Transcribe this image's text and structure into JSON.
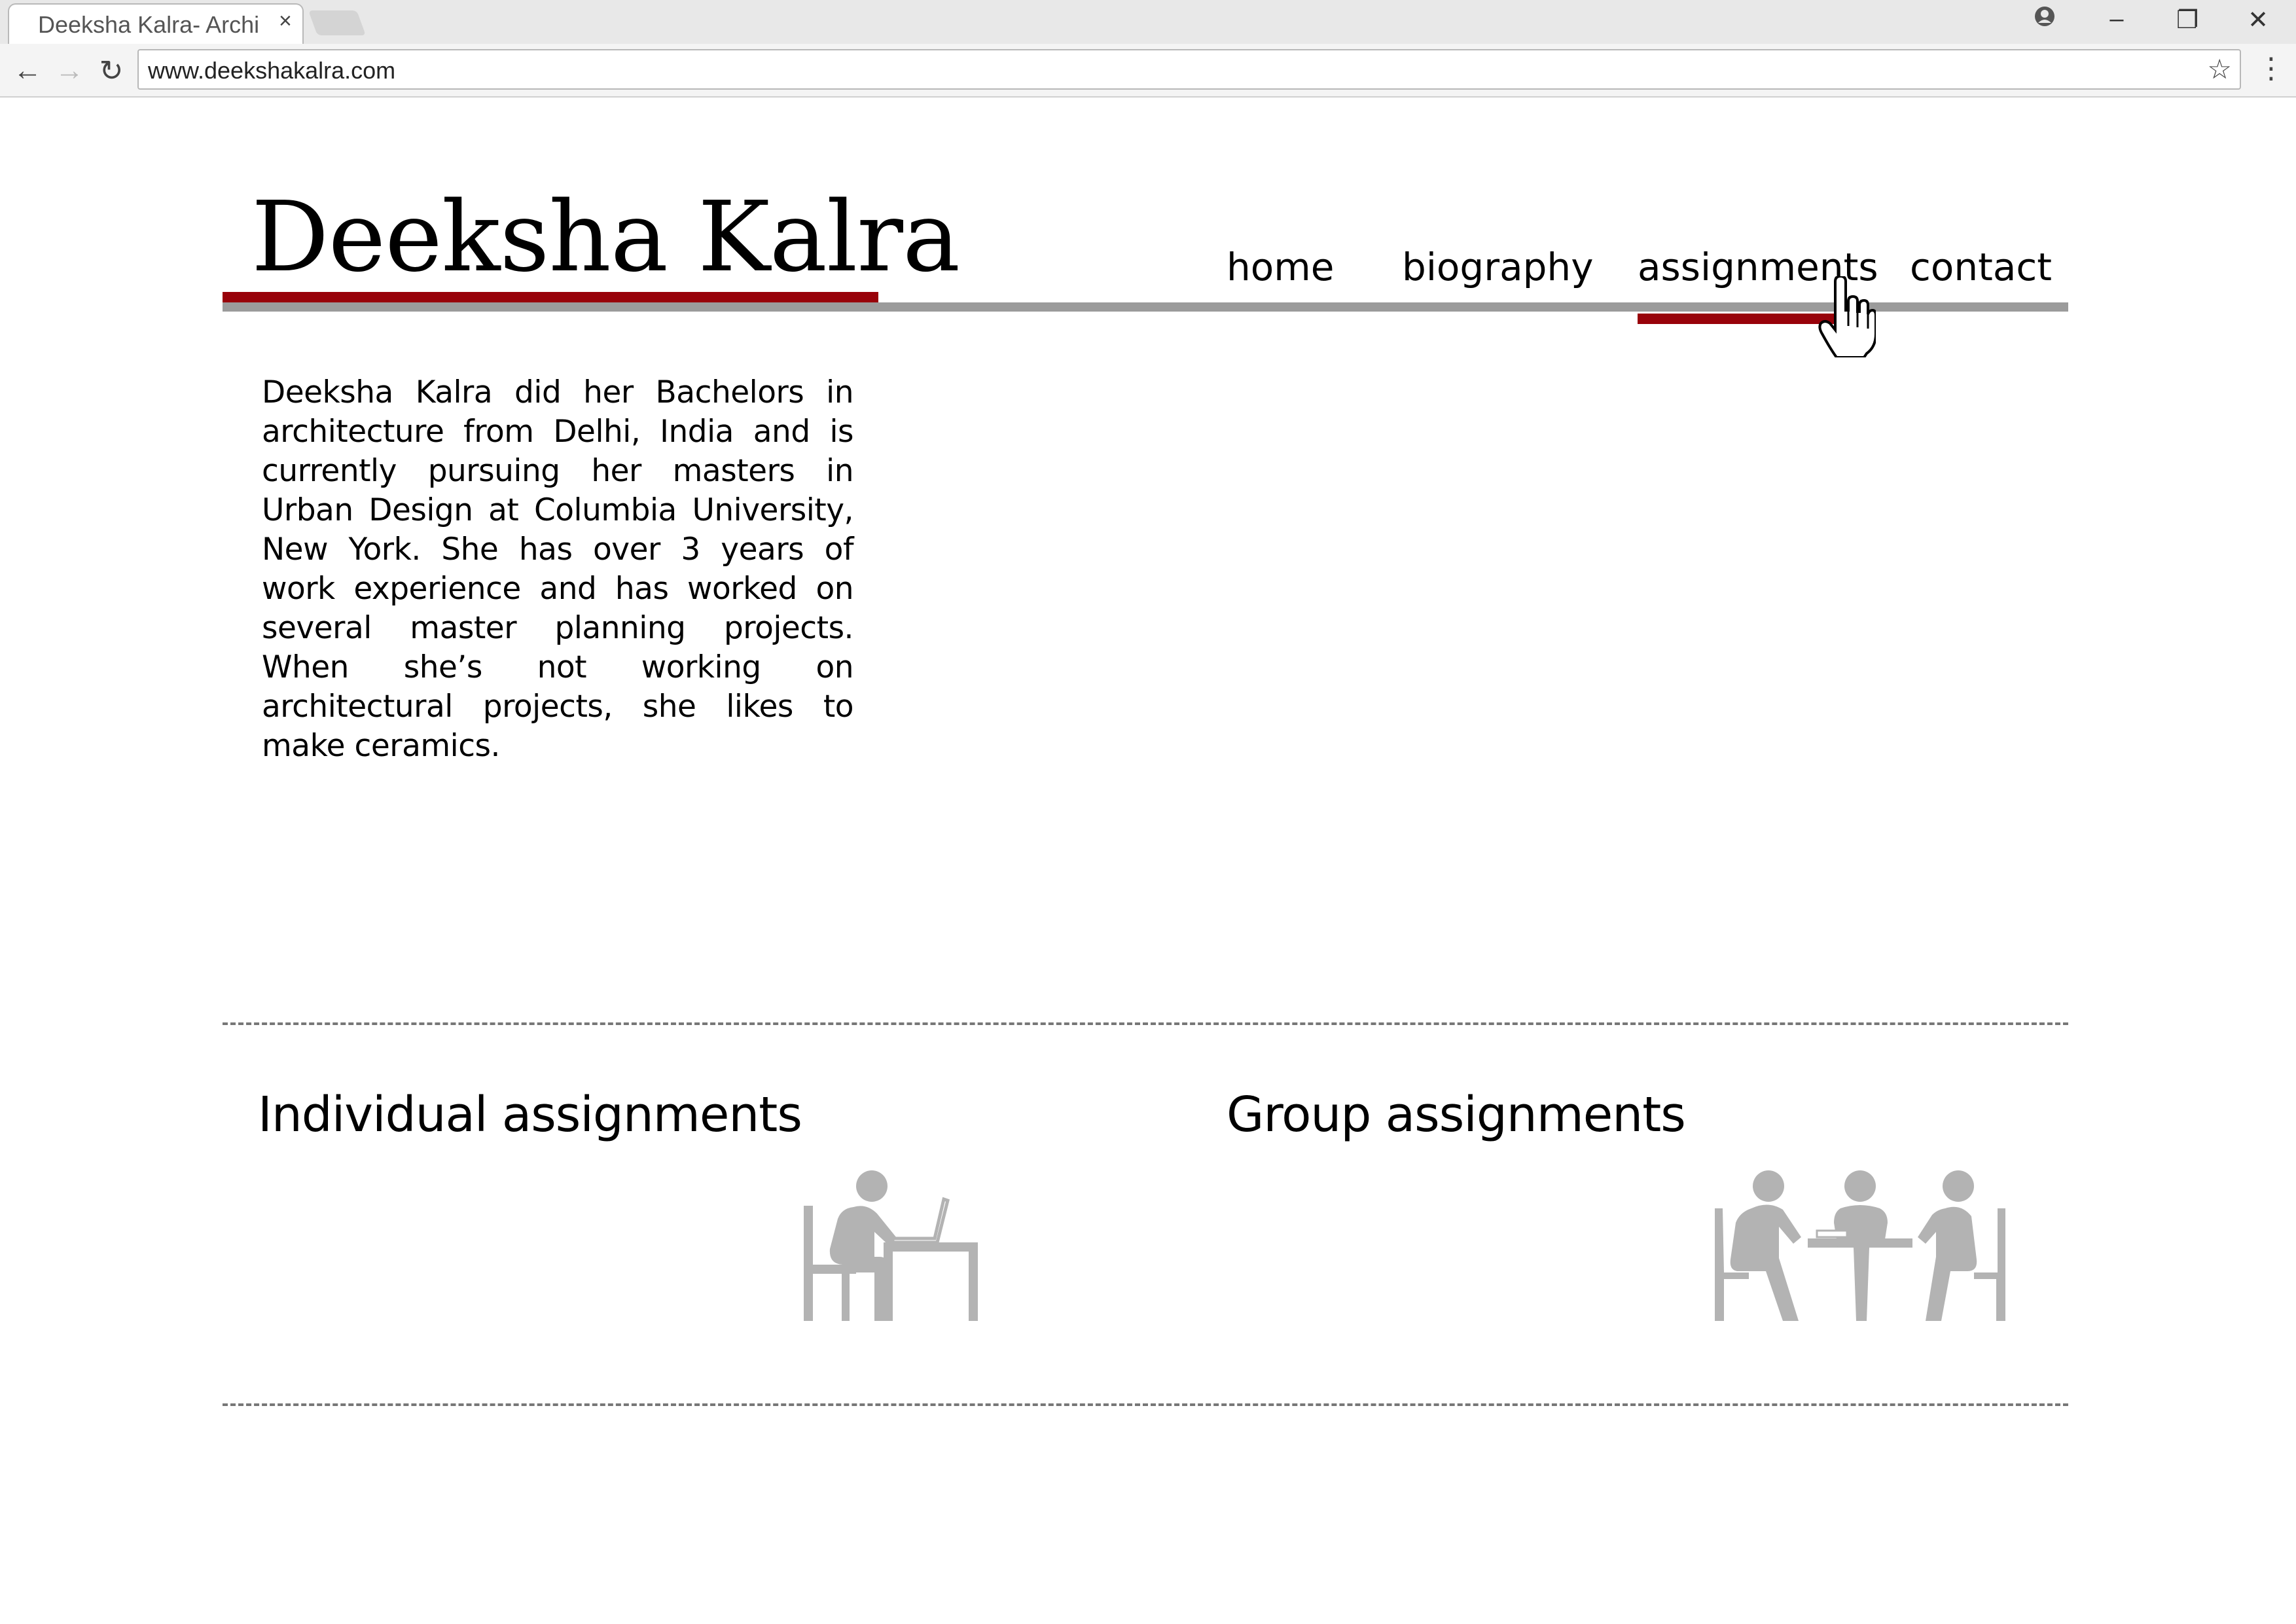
{
  "browser": {
    "tab_title": "Deeksha Kalra- Archi",
    "tab_close": "×",
    "url": "www.deekshakalra.com",
    "controls": {
      "back": "←",
      "forward": "→",
      "reload": "↻",
      "star": "☆",
      "menu": "⋮",
      "profile": "●",
      "minimize": "–",
      "restore": "❐",
      "close": "✕"
    }
  },
  "site": {
    "title": "Deeksha Kalra",
    "accent_color": "#98020a",
    "rule_color": "#9b9b9b",
    "nav": [
      {
        "label": "home",
        "active": false
      },
      {
        "label": "biography",
        "active": false
      },
      {
        "label": "assignments",
        "active": true
      },
      {
        "label": "contact",
        "active": false
      }
    ],
    "bio": "Deeksha Kalra did her Bachelors in architecture from Delhi, India and is currently pursuing her masters in Urban Design at Columbia University, New York. She has over 3 years of work experience and has worked on several master planning projects.  When she’s not working on architectural projects, she likes to make ceramics.",
    "sections": {
      "individual": {
        "heading": "Individual assignments",
        "icon": "person-at-desk-icon"
      },
      "group": {
        "heading": "Group assignments",
        "icon": "group-meeting-icon"
      }
    },
    "icon_color": "#b3b3b3"
  }
}
